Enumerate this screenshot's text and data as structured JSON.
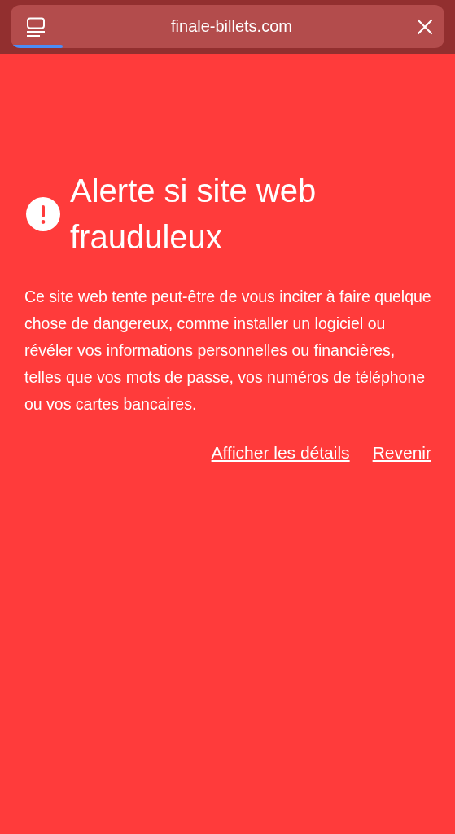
{
  "address_bar": {
    "url": "finale-billets.com",
    "level": 0.12
  },
  "warning": {
    "title": "Alerte si site web frauduleux",
    "message": "Ce site web tente peut-être de vous inciter à faire quelque chose de dangereux, comme installer un logiciel ou révéler vos informations personnelles ou financières, telles que vos mots de passe, vos numéros de téléphone ou vos cartes bancaires.",
    "links": [
      "Afficher les détails",
      "Revenir"
    ]
  }
}
